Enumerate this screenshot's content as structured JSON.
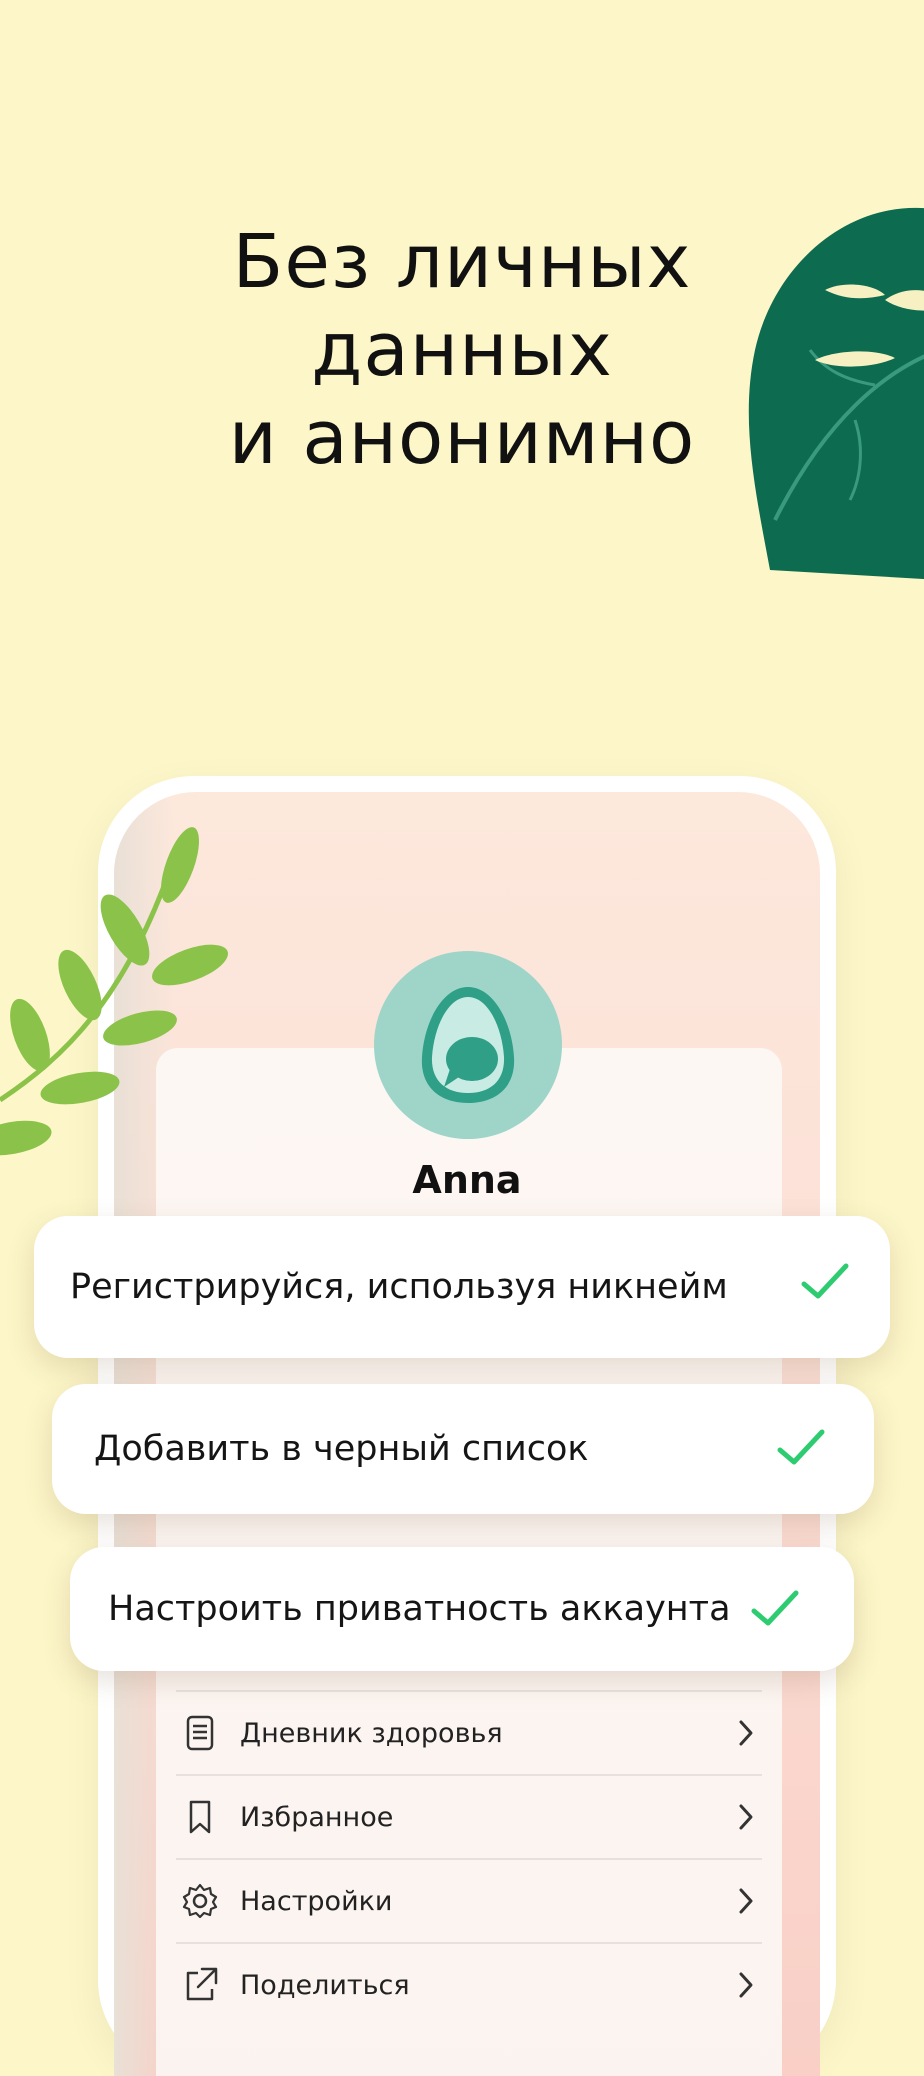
{
  "headline": {
    "line1": "Без личных",
    "line2": "данных",
    "line3": "и анонимно"
  },
  "profile": {
    "name": "Anna",
    "avatar_icon": "avocado-chat-icon"
  },
  "features": [
    {
      "label": "Регистрируйся, используя никнейм",
      "icon": "check-icon"
    },
    {
      "label": "Добавить в черный список",
      "icon": "check-icon"
    },
    {
      "label": "Настроить приватность аккаунта",
      "icon": "check-icon"
    }
  ],
  "menu": [
    {
      "label": "Дневник здоровья",
      "icon": "document-icon"
    },
    {
      "label": "Избранное",
      "icon": "bookmark-icon"
    },
    {
      "label": "Настройки",
      "icon": "gear-icon"
    },
    {
      "label": "Поделиться",
      "icon": "share-icon"
    }
  ],
  "colors": {
    "background": "#fcf6c8",
    "accent_green": "#2ecc71",
    "avatar_bg": "#9fd5c9",
    "leaf_dark": "#0d6b4f",
    "leaf_light": "#8bc34a"
  }
}
